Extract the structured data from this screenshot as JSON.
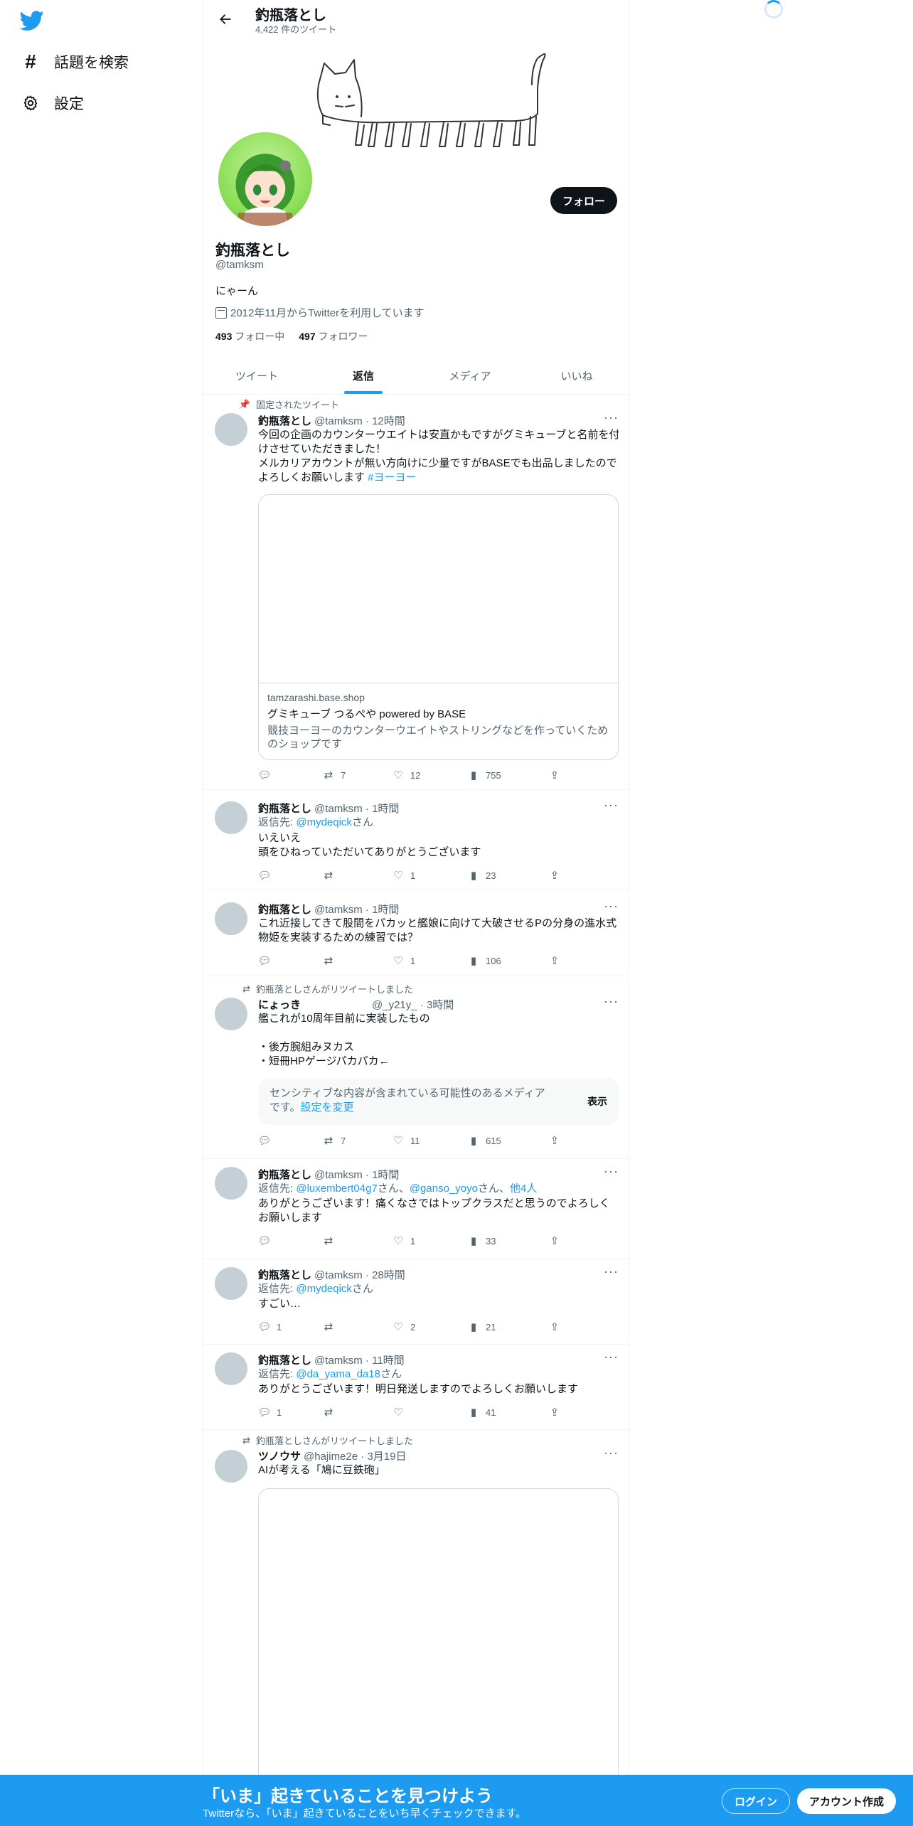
{
  "sidebar": {
    "logo": "twitter-bird-icon",
    "items": [
      {
        "icon": "hashtag-icon",
        "label": "話題を検索"
      },
      {
        "icon": "gear-icon",
        "label": "設定"
      }
    ]
  },
  "header": {
    "name": "釣瓶落とし",
    "tweet_count": "4,422 件のツイート"
  },
  "profile": {
    "name": "釣瓶落とし",
    "handle": "@tamksm",
    "bio": "にゃーん",
    "joined": "2012年11月からTwitterを利用しています",
    "following_count": "493",
    "following_label": "フォロー中",
    "followers_count": "497",
    "followers_label": "フォロワー",
    "follow_button": "フォロー"
  },
  "tabs": [
    {
      "label": "ツイート",
      "active": false
    },
    {
      "label": "返信",
      "active": true
    },
    {
      "label": "メディア",
      "active": false
    },
    {
      "label": "いいね",
      "active": false
    }
  ],
  "tweets": [
    {
      "social": "固定されたツイート",
      "name": "釣瓶落とし",
      "meta": "@tamksm · 12時間",
      "text": "今回の企画のカウンターウエイトは安直かもですがグミキューブと名前を付けさせていただきました！\nメルカリアカウントが無い方向けに少量ですがBASEでも出品しましたのでよろしくお願いします ",
      "hashtag": "#ヨーヨー",
      "card": {
        "domain": "tamzarashi.base.shop",
        "title": "グミキューブ つるぺや powered by BASE",
        "desc": "競技ヨーヨーのカウンターウエイトやストリングなどを作っていくためのショップです"
      },
      "reply": "",
      "retweet": "7",
      "like": "12",
      "views": "755"
    },
    {
      "name": "釣瓶落とし",
      "meta": "@tamksm · 1時間",
      "reply_prefix": "返信先: ",
      "reply_to": "@mydeqick",
      "reply_suffix": "さん",
      "text": "いえいえ\n頭をひねっていただいてありがとうございます",
      "reply": "",
      "retweet": "",
      "like": "1",
      "views": "23"
    },
    {
      "name": "釣瓶落とし",
      "meta": "@tamksm · 1時間",
      "text": "これ近接してきて股間をパカッと艦娘に向けて大破させるPの分身の進水式物姫を実装するための練習では？",
      "reply": "",
      "retweet": "",
      "like": "1",
      "views": "106"
    },
    {
      "social": "釣瓶落としさんがリツイートしました",
      "name": "にょっき",
      "meta": "@_y21y_ · 3時間",
      "text": "艦これが10周年目前に実装したもの\n\n・後方腕組みヌカス\n・短冊HPゲージパカパカ←",
      "sensitive_text": "センシティブな内容が含まれている可能性のあるメディアです。",
      "sensitive_link": "設定を変更",
      "sensitive_button": "表示",
      "reply": "",
      "retweet": "7",
      "like": "11",
      "views": "615"
    },
    {
      "name": "釣瓶落とし",
      "meta": "@tamksm · 1時間",
      "reply_prefix": "返信先: ",
      "reply_to": "@luxembert04g7",
      "reply_mid": "さん、",
      "reply_to2": "@ganso_yoyo",
      "reply_mid2": "さん、",
      "reply_others": "他4人",
      "text": "ありがとうございます！痛くなさではトップクラスだと思うのでよろしくお願いします",
      "reply": "",
      "retweet": "",
      "like": "1",
      "views": "33"
    },
    {
      "name": "釣瓶落とし",
      "meta": "@tamksm · 28時間",
      "reply_prefix": "返信先: ",
      "reply_to": "@mydeqick",
      "reply_suffix": "さん",
      "text": "すごい…",
      "reply": "1",
      "retweet": "",
      "like": "2",
      "views": "21"
    },
    {
      "name": "釣瓶落とし",
      "meta": "@tamksm · 11時間",
      "reply_prefix": "返信先: ",
      "reply_to": "@da_yama_da18",
      "reply_suffix": "さん",
      "text": "ありがとうございます！明日発送しますのでよろしくお願いします",
      "reply": "1",
      "retweet": "",
      "like": "",
      "views": "41"
    },
    {
      "social": "釣瓶落としさんがリツイートしました",
      "name": "ツノウサ",
      "meta": "@hajime2e · 3月19日",
      "text": "AIが考える「鳩に豆鉄砲」"
    }
  ],
  "bottom_bar": {
    "title": "「いま」起きていることを見つけよう",
    "subtitle": "Twitterなら、「いま」起きていることをいち早くチェックできます。",
    "login": "ログイン",
    "signup": "アカウント作成"
  },
  "colors": {
    "accent": "#1d9bf0",
    "text": "#0f1419",
    "secondary": "#536471"
  }
}
